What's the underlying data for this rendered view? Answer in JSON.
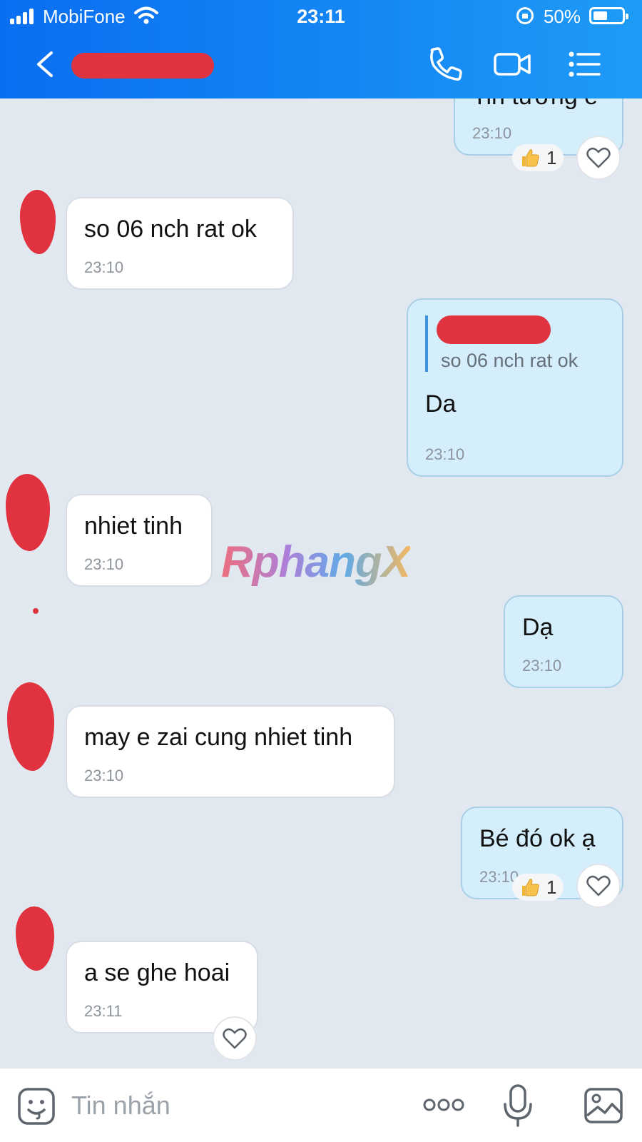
{
  "status_bar": {
    "carrier": "MobiFone",
    "time": "23:11",
    "battery_percent": "50%",
    "battery_level": 0.5
  },
  "header": {
    "contact_name_redacted": true,
    "icons": [
      "back-icon",
      "phone-icon",
      "video-call-icon",
      "menu-icon"
    ]
  },
  "messages": [
    {
      "dir": "out",
      "text": "Tin tưởng e",
      "time": "23:10",
      "reaction": {
        "emoji": "thumbs-up",
        "count": "1"
      }
    },
    {
      "dir": "in",
      "text": "so 06 nch rat ok",
      "time": "23:10"
    },
    {
      "dir": "out",
      "quote": "so 06 nch rat ok",
      "text": "Da",
      "time": "23:10"
    },
    {
      "dir": "in",
      "text": "nhiet tinh",
      "time": "23:10"
    },
    {
      "dir": "out",
      "text": "Dạ",
      "time": "23:10"
    },
    {
      "dir": "in",
      "text": "may e zai cung nhiet tinh",
      "time": "23:10"
    },
    {
      "dir": "out",
      "text": "Bé đó ok ạ",
      "time": "23:10",
      "reaction": {
        "emoji": "thumbs-up",
        "count": "1"
      }
    },
    {
      "dir": "in",
      "text": "a se ghe hoai",
      "time": "23:11"
    }
  ],
  "watermark": "RphangX",
  "input": {
    "placeholder": "Tin nhắn"
  },
  "colors": {
    "header_gradient_start": "#0a6ef0",
    "header_gradient_end": "#1e9bf7",
    "chat_background": "#e2e8f0",
    "incoming_bubble": "#ffffff",
    "outgoing_bubble": "#d4eefc",
    "redaction": "#e0323f"
  }
}
